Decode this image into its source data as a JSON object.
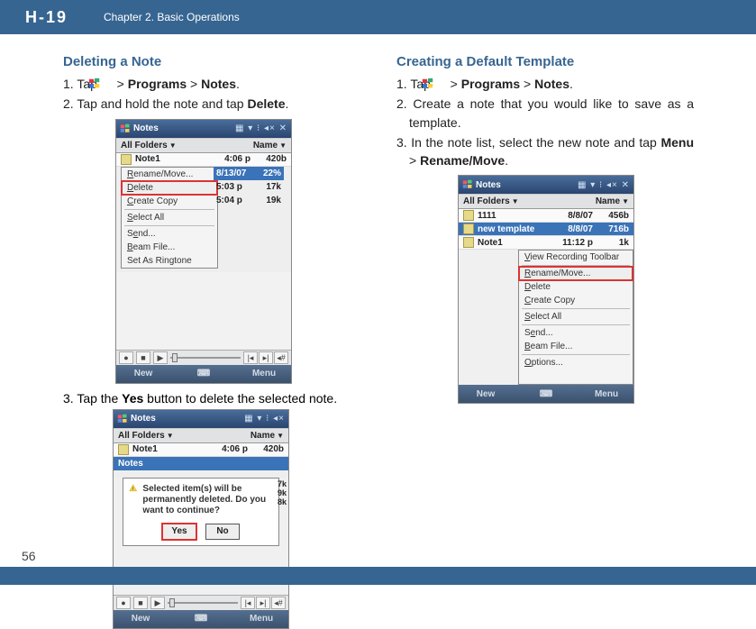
{
  "header": {
    "logo": "H-19",
    "chapter": "Chapter 2. Basic Operations"
  },
  "page_number": "56",
  "left": {
    "title": "Deleting a Note",
    "step1": {
      "prefix": "1. Tap ",
      "nav1": "Programs",
      "nav2": "Notes",
      "suffix": "."
    },
    "step2": {
      "prefix": "2. Tap and hold the note and tap ",
      "bold": "Delete",
      "suffix": "."
    },
    "step3": {
      "prefix": "3. Tap the ",
      "bold": "Yes",
      "mid": " button to delete the selected note."
    }
  },
  "right": {
    "title": "Creating a Default Template",
    "step1": {
      "prefix": "1. Tap ",
      "nav1": "Programs",
      "nav2": "Notes",
      "suffix": "."
    },
    "step2": "2. Create a note that you would like to save as a template.",
    "step3": {
      "prefix": "3. In the note list, select the new note and tap ",
      "b1": "Menu",
      "b2": "Rename/Move",
      "suffix": "."
    }
  },
  "shotA": {
    "title": "Notes",
    "allfolders": "All Folders",
    "name": "Name",
    "row": {
      "name": "Note1",
      "time": "4:06 p",
      "size": "420b"
    },
    "selrow": {
      "date": "8/13/07",
      "pct": "22%"
    },
    "side1": {
      "t": "5:03 p",
      "s": "17k"
    },
    "side2": {
      "t": "5:04 p",
      "s": "19k"
    },
    "menu": {
      "rename": "Rename/Move...",
      "delete": "Delete",
      "copy": "Create Copy",
      "selectall": "Select All",
      "send": "Send...",
      "beam": "Beam File...",
      "ringtone": "Set As Ringtone"
    },
    "soft": {
      "left": "New",
      "right": "Menu"
    }
  },
  "shotB": {
    "title": "Notes",
    "allfolders": "All Folders",
    "name": "Name",
    "row": {
      "name": "Note1",
      "time": "4:06 p",
      "size": "420b"
    },
    "subhead": "Notes",
    "dialog": {
      "msg": "Selected item(s) will be permanently deleted. Do you want to continue?",
      "yes": "Yes",
      "no": "No"
    },
    "soft": {
      "left": "New",
      "right": "Menu"
    }
  },
  "shotC": {
    "title": "Notes",
    "allfolders": "All Folders",
    "name": "Name",
    "row1": {
      "name": "1111",
      "time": "8/8/07",
      "size": "456b"
    },
    "row2": {
      "name": "new template",
      "time": "8/8/07",
      "size": "716b"
    },
    "row3": {
      "name": "Note1",
      "time": "11:12 p",
      "size": "1k"
    },
    "menu": {
      "viewtoolbar": "View Recording Toolbar",
      "rename": "Rename/Move...",
      "delete": "Delete",
      "copy": "Create Copy",
      "selectall": "Select All",
      "send": "Send...",
      "beam": "Beam File...",
      "options": "Options..."
    },
    "soft": {
      "left": "New",
      "right": "Menu"
    }
  }
}
